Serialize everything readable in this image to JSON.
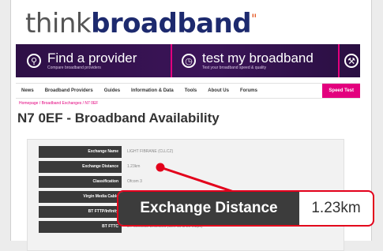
{
  "logo": {
    "think": "think",
    "broadband": "broadband",
    "mark": "\""
  },
  "banner": {
    "find_provider": "Find a provider",
    "find_provider_sub": "Compare broadband providers",
    "test_broadband": "test my broadband",
    "test_broadband_sub": "Test your broadband speed & quality"
  },
  "nav": {
    "items": [
      "News",
      "Broadband Providers",
      "Guides",
      "Information & Data",
      "Tools",
      "About Us",
      "Forums"
    ],
    "speed_test": "Speed Test"
  },
  "breadcrumb": "Homepage / Broadband Exchanges / N7 0EF",
  "page_title": "N7 0EF - Broadband Availability",
  "table": {
    "rows": [
      {
        "label": "Exchange Name",
        "value": "LIGHT FIBRANE (CLLCZ)"
      },
      {
        "label": "Exchange Distance",
        "value": "1.23km"
      },
      {
        "label": "Classification",
        "value": "Ofcom 3"
      },
      {
        "label": "Virgin Media Cable",
        "value": ""
      },
      {
        "label": "BT FTTP/Infinity",
        "value": ""
      },
      {
        "label": "BT FTTC",
        "value": "BT Wireless Unlimited (Gen 10 & 20 Mbps)"
      }
    ]
  },
  "callout": {
    "label": "Exchange Distance",
    "value": "1.23km"
  },
  "colors": {
    "brand_navy": "#1d2a6e",
    "banner_purple": "#3b1458",
    "accent_pink": "#e3007e",
    "callout_red": "#e3001b"
  }
}
